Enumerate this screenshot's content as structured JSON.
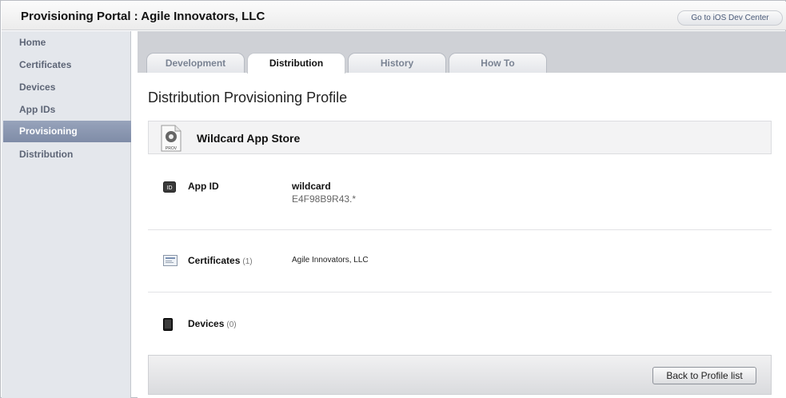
{
  "header": {
    "title": "Provisioning Portal : Agile Innovators, LLC",
    "dev_center_link": "Go to iOS Dev Center"
  },
  "sidebar": {
    "items": [
      {
        "label": "Home"
      },
      {
        "label": "Certificates"
      },
      {
        "label": "Devices"
      },
      {
        "label": "App IDs"
      },
      {
        "label": "Provisioning",
        "active": true
      },
      {
        "label": "Distribution"
      }
    ]
  },
  "tabs": [
    {
      "label": "Development"
    },
    {
      "label": "Distribution",
      "active": true
    },
    {
      "label": "History"
    },
    {
      "label": "How To"
    }
  ],
  "main": {
    "page_title": "Distribution Provisioning Profile",
    "profile": {
      "icon_text": "PROV",
      "name": "Wildcard App Store"
    },
    "app_id": {
      "icon_text": "ID",
      "label": "App ID",
      "name": "wildcard",
      "identifier": "E4F98B9R43.*"
    },
    "certificates": {
      "label": "Certificates",
      "count": "(1)",
      "value": "Agile Innovators, LLC"
    },
    "devices": {
      "label": "Devices",
      "count": "(0)"
    },
    "back_button": "Back to Profile list"
  },
  "colors": {
    "active_nav": "#8a96b0",
    "sidebar_bg": "#e4e7ec",
    "tabbar_bg": "#cfd1d6"
  }
}
